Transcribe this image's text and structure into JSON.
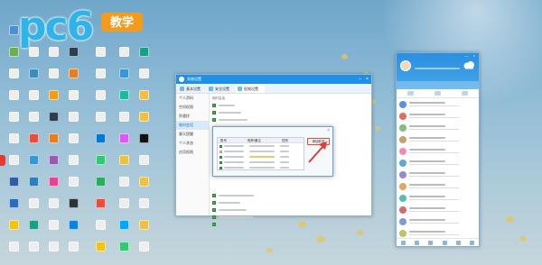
{
  "watermark": {
    "brand": "pc6",
    "badge": "教学"
  },
  "desktop": {
    "icons": [
      {
        "label": "",
        "color": "#4a90d9"
      },
      {
        "label": "",
        "color": "#6ab04c"
      },
      {
        "label": "",
        "color": "#eeeeee"
      },
      {
        "label": "",
        "color": "#eeeeee"
      },
      {
        "label": "",
        "color": "#eeeeee"
      },
      {
        "label": "",
        "color": "#eeeeee"
      },
      {
        "label": "",
        "color": "#eeeeee"
      },
      {
        "label": "",
        "color": "#2d5fa8"
      },
      {
        "label": "",
        "color": "#2c6bbf"
      },
      {
        "label": "",
        "color": "#f1c40f"
      },
      {
        "label": "",
        "color": "#eeeeee"
      },
      {
        "label": "",
        "color": "#eeeeee"
      },
      {
        "label": "",
        "color": "#3c8dbc"
      },
      {
        "label": "",
        "color": "#eeeeee"
      },
      {
        "label": "",
        "color": "#eeeeee"
      },
      {
        "label": "",
        "color": "#e74c3c"
      },
      {
        "label": "",
        "color": "#3498db"
      },
      {
        "label": "",
        "color": "#2980b9"
      },
      {
        "label": "",
        "color": "#eeeeee"
      },
      {
        "label": "",
        "color": "#16a085"
      },
      {
        "label": "",
        "color": "#eeeeee"
      },
      {
        "label": "",
        "color": "#eeeeee"
      },
      {
        "label": "",
        "color": "#eeeeee"
      },
      {
        "label": "",
        "color": "#f39c12"
      },
      {
        "label": "",
        "color": "#2c3e50"
      },
      {
        "label": "",
        "color": "#e67e22"
      },
      {
        "label": "",
        "color": "#9b59b6"
      },
      {
        "label": "",
        "color": "#e84393"
      },
      {
        "label": "",
        "color": "#eeeeee"
      },
      {
        "label": "",
        "color": "#eeeeee"
      },
      {
        "label": "",
        "color": "#eeeeee"
      },
      {
        "label": "",
        "color": "#2c3e50"
      },
      {
        "label": "",
        "color": "#e67e22"
      },
      {
        "label": "",
        "color": "#eeeeee"
      },
      {
        "label": "",
        "color": "#eeeeee"
      },
      {
        "label": "",
        "color": "#eeeeee"
      },
      {
        "label": "",
        "color": "#eeeeee"
      },
      {
        "label": "",
        "color": "#eeeeee"
      },
      {
        "label": "",
        "color": "#2d3436"
      },
      {
        "label": "",
        "color": "#0984e3"
      },
      {
        "label": "",
        "color": "#eeeeee"
      },
      {
        "label": "",
        "color": "#eeeeee"
      },
      {
        "label": "",
        "color": "#eeeeee"
      },
      {
        "label": "",
        "color": "#eeeeee"
      },
      {
        "label": "",
        "color": "#eeeeee"
      },
      {
        "label": "",
        "color": "#0078d7"
      },
      {
        "label": "",
        "color": "#2ecc71"
      },
      {
        "label": "",
        "color": "#27ae60"
      },
      {
        "label": "",
        "color": "#e74c3c"
      },
      {
        "label": "",
        "color": "#eeeeee"
      },
      {
        "label": "",
        "color": "#f1c40f"
      },
      {
        "label": "",
        "color": "#eeeeee"
      },
      {
        "label": "",
        "color": "#3498db"
      },
      {
        "label": "",
        "color": "#1abc9c"
      },
      {
        "label": "",
        "color": "#eeeeee"
      },
      {
        "label": "",
        "color": "#e056fd"
      },
      {
        "label": "",
        "color": "#f0c040"
      },
      {
        "label": "",
        "color": "#eeeeee"
      },
      {
        "label": "",
        "color": "#eeeeee"
      },
      {
        "label": "",
        "color": "#00a8ff"
      },
      {
        "label": "",
        "color": "#2ecc71"
      },
      {
        "label": "",
        "color": "#16a085"
      },
      {
        "label": "",
        "color": "#eeeeee"
      },
      {
        "label": "",
        "color": "#f0c040"
      },
      {
        "label": "",
        "color": "#f0c040"
      },
      {
        "label": "",
        "color": "#111111"
      },
      {
        "label": "",
        "color": "#eeeeee"
      },
      {
        "label": "",
        "color": "#f0c040"
      },
      {
        "label": "",
        "color": "#eeeeee"
      },
      {
        "label": "",
        "color": "#f0c040"
      },
      {
        "label": "",
        "color": "#eeeeee"
      },
      {
        "label": "",
        "color": "#2d6cdf"
      },
      {
        "label": "",
        "color": "#eeeeee"
      },
      {
        "label": "",
        "color": "#eeeeee"
      },
      {
        "label": "",
        "color": "#0f9d58"
      },
      {
        "label": "",
        "color": "#eeeeee"
      },
      {
        "label": "",
        "color": "#eeeeee"
      },
      {
        "label": "",
        "color": "#1e88e5"
      },
      {
        "label": "",
        "color": "#27ae60"
      },
      {
        "label": "",
        "color": "#eeeeee"
      },
      {
        "label": "",
        "color": "#eeeeee"
      },
      {
        "label": "",
        "color": "#f0c040"
      },
      {
        "label": "",
        "color": "#eeeeee"
      },
      {
        "label": "",
        "color": "#0078d7"
      }
    ]
  },
  "settings_window": {
    "title": "系统设置",
    "tabs": [
      "基本设置",
      "安全设置",
      "权限设置"
    ],
    "active_tab": 2,
    "sidebar": [
      "个人资料",
      "空间权限",
      "防骚扰",
      "临时会话",
      "聊天提醒",
      "个人状态",
      "应用权限"
    ],
    "active_side": 3,
    "sections": [
      "临时会话"
    ],
    "options": [
      "",
      "",
      "",
      "",
      "",
      "",
      "",
      ""
    ]
  },
  "dialog": {
    "columns": [
      "账号",
      "昵称/备注",
      "性别"
    ],
    "row_count": 5,
    "action_label": "添加好友",
    "close": "×"
  },
  "qq_panel": {
    "window_controls": "— ×",
    "contacts": [
      {
        "color": "#5b8def"
      },
      {
        "color": "#e86b5f"
      },
      {
        "color": "#7fbf7f"
      },
      {
        "color": "#c7a26b"
      },
      {
        "color": "#f28bb5"
      },
      {
        "color": "#5fa8d3"
      },
      {
        "color": "#9b87d6"
      },
      {
        "color": "#e8a15f"
      },
      {
        "color": "#4fc1b3"
      },
      {
        "color": "#d66b6b"
      },
      {
        "color": "#7d9bd1"
      },
      {
        "color": "#b5c95f"
      }
    ]
  },
  "colors": {
    "qq_blue": "#1f90e8",
    "check_green": "#4caf50",
    "highlight_red": "#e34b3d",
    "badge_orange": "#f59a1b",
    "logo_cyan": "#2eb4e8"
  }
}
